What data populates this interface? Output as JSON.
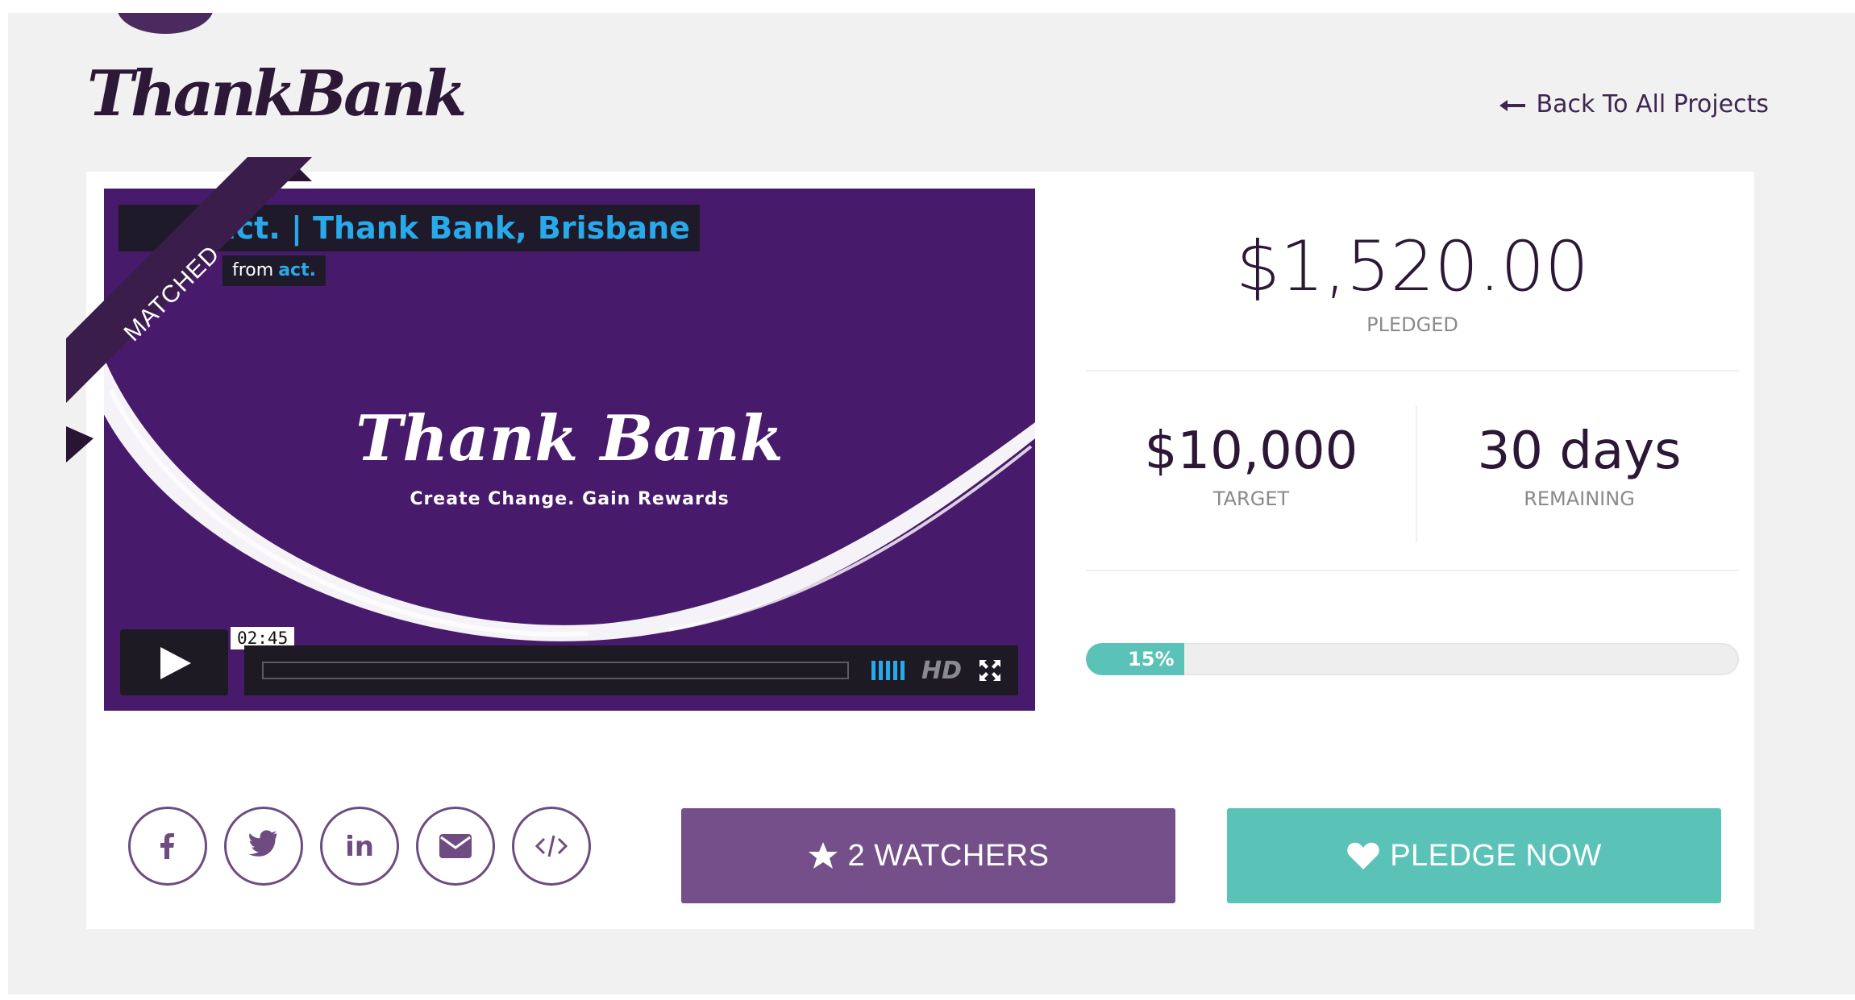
{
  "header": {
    "logo": "ThankBank",
    "back_link": "Back To All Projects",
    "back_icon": "arrow-left-icon"
  },
  "video": {
    "title": "act. | Thank Bank, Brisbane",
    "from_label": "from",
    "from_name": "act.",
    "brand": "Thank Bank",
    "tagline": "Create Change. Gain Rewards",
    "timestamp": "02:45",
    "hd_label": "HD"
  },
  "ribbon": {
    "label": "MATCHED"
  },
  "stats": {
    "pledged_amount": "$1,520.00",
    "pledged_label": "PLEDGED",
    "target_value": "$10,000",
    "target_label": "TARGET",
    "remaining_value": "30 days",
    "remaining_label": "REMAINING",
    "progress_text": "15%",
    "progress_fraction": 0.15
  },
  "social": [
    "facebook-icon",
    "twitter-icon",
    "linkedin-icon",
    "email-icon",
    "embed-code-icon"
  ],
  "actions": {
    "watchers_label": "2 WATCHERS",
    "pledge_label": "PLEDGE NOW"
  },
  "colors": {
    "brand_purple": "#744f89",
    "teal": "#5bc2b8",
    "dark_text": "#2c1836",
    "video_bg": "#481a6c"
  }
}
